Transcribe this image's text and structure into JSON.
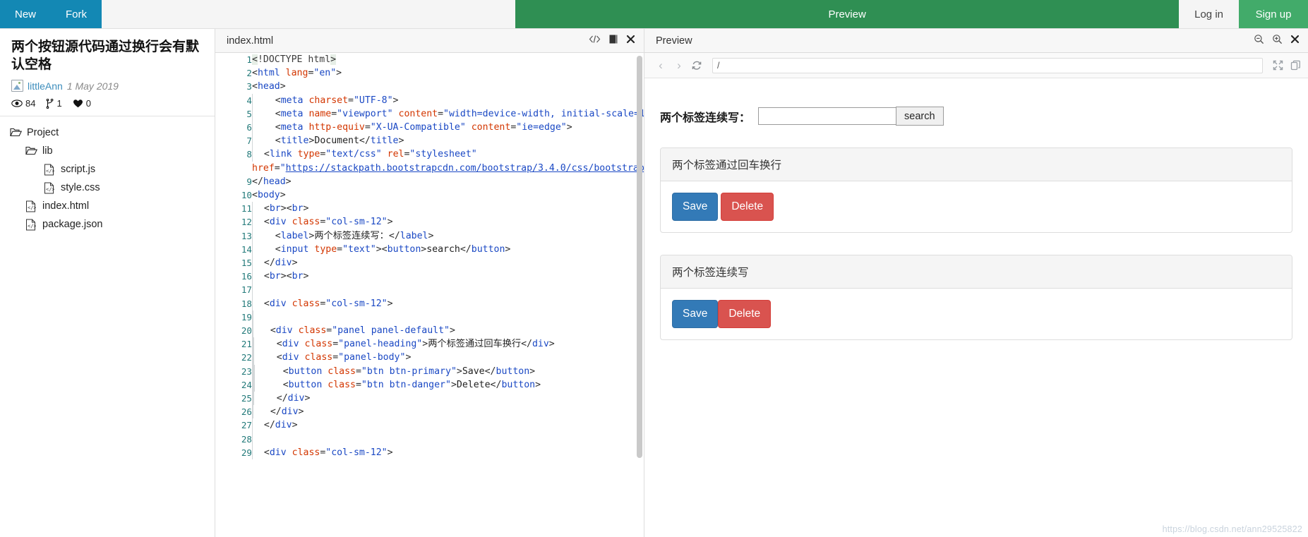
{
  "topbar": {
    "new_label": "New",
    "fork_label": "Fork",
    "preview_label": "Preview",
    "login_label": "Log in",
    "signup_label": "Sign up",
    "colors": {
      "blue": "#1388b4",
      "green_dark": "#2f8f53",
      "green": "#42ab6a"
    }
  },
  "sidebar": {
    "gist_title": "两个按钮源代码通过换行会有默认空格",
    "author": "littleAnn",
    "date": "1 May 2019",
    "stats": {
      "views": "84",
      "forks": "1",
      "likes": "0"
    },
    "tree": [
      {
        "label": "Project",
        "type": "folder",
        "indent": 0
      },
      {
        "label": "lib",
        "type": "folder",
        "indent": 1
      },
      {
        "label": "script.js",
        "type": "file",
        "indent": 2
      },
      {
        "label": "style.css",
        "type": "file",
        "indent": 2
      },
      {
        "label": "index.html",
        "type": "file",
        "indent": 1
      },
      {
        "label": "package.json",
        "type": "file",
        "indent": 1
      }
    ]
  },
  "editor": {
    "tab_title": "index.html",
    "icons": [
      "code-icon",
      "book-icon",
      "close-icon"
    ],
    "lines": [
      "1",
      "2",
      "3",
      "4",
      "5",
      "6",
      "7",
      "8",
      "",
      "9",
      "10",
      "11",
      "12",
      "13",
      "14",
      "15",
      "16",
      "17",
      "18",
      "19",
      "20",
      "21",
      "22",
      "23",
      "24",
      "25",
      "26",
      "27",
      "28",
      "29"
    ]
  },
  "preview": {
    "title": "Preview",
    "header_icons": [
      "zoom-out-icon",
      "zoom-in-icon",
      "close-icon"
    ],
    "toolbar": {
      "back": "back-icon",
      "forward": "forward-icon",
      "refresh": "refresh-icon",
      "url": "/",
      "expand": "expand-icon",
      "popout": "popout-icon"
    },
    "form": {
      "label": "两个标签连续写：",
      "input_value": "",
      "input_placeholder": "",
      "search_label": "search"
    },
    "panels": [
      {
        "heading": "两个标签通过回车换行",
        "save_label": "Save",
        "delete_label": "Delete",
        "spaced": true
      },
      {
        "heading": "两个标签连续写",
        "save_label": "Save",
        "delete_label": "Delete",
        "spaced": false
      }
    ],
    "watermark": "https://blog.csdn.net/ann29525822"
  }
}
